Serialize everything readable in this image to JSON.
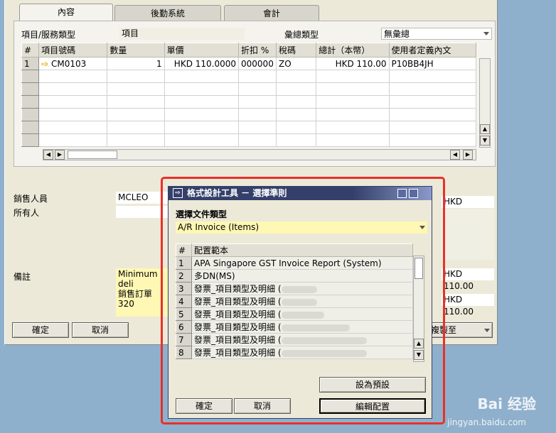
{
  "tabs": [
    "內容",
    "後勤系統",
    "會計"
  ],
  "header": {
    "item_type_label": "項目/服務類型",
    "item_type_value": "項目",
    "summary_type_label": "彙總類型",
    "summary_type_value": "無彙總"
  },
  "items_table": {
    "columns": [
      "#",
      "項目號碼",
      "數量",
      "單價",
      "折扣 %",
      "稅碼",
      "總計（本幣）",
      "使用者定義內文"
    ],
    "rows": [
      [
        "1",
        "CM0103",
        "1",
        "HKD 110.0000",
        "000000",
        "ZO",
        "HKD 110.00",
        "P10BB4JH"
      ]
    ],
    "empty_rows": 6
  },
  "footer": {
    "sales_person_label": "銷售人員",
    "sales_person_value": "MCLEO",
    "owner_label": "所有人",
    "remarks_label": "備註",
    "remarks_line1": "Minimum deli",
    "remarks_line2": "銷售訂單 320",
    "totals": [
      "HKD 110.00",
      "HKD 110.00",
      "HKD 110.00"
    ],
    "ok_button": "確定",
    "cancel_button": "取消",
    "copy_to_button": "複製至"
  },
  "dialog": {
    "title": "格式設計工具 － 選擇準則",
    "doc_type_label": "選擇文件類型",
    "doc_type_value": "A/R Invoice (Items)",
    "columns": [
      "#",
      "配置範本"
    ],
    "rows": [
      {
        "num": "1",
        "name": "APA Singapore GST Invoice Report (System)"
      },
      {
        "num": "2",
        "name": "多DN(MS)"
      },
      {
        "num": "3",
        "name": "發票_項目類型及明細 ("
      },
      {
        "num": "4",
        "name": "發票_項目類型及明細 ("
      },
      {
        "num": "5",
        "name": "發票_項目類型及明細 ("
      },
      {
        "num": "6",
        "name": "發票_項目類型及明細 ("
      },
      {
        "num": "7",
        "name": "發票_項目類型及明細 ("
      },
      {
        "num": "8",
        "name": "發票_項目類型及明細 ("
      }
    ],
    "set_default_button": "設為預設",
    "ok_button": "確定",
    "cancel_button": "取消",
    "edit_layout_button": "編輯配置"
  },
  "watermark": {
    "text": "Bai 经验",
    "url": "jingyan.baidu.com"
  }
}
